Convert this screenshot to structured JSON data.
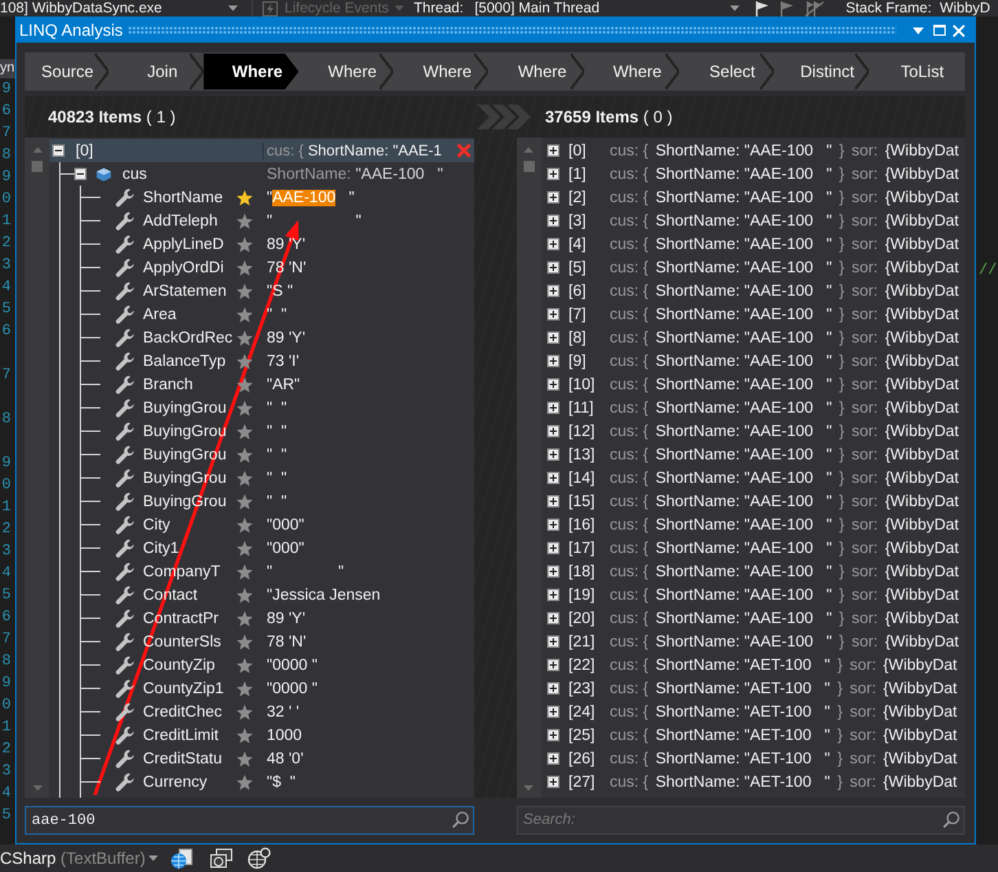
{
  "toolbar": {
    "process": "108] WibbyDataSync.exe",
    "lifecycle": {
      "label": "Lifecycle Events",
      "disabled": true
    },
    "thread_label": "Thread:",
    "thread": "[5000] Main Thread",
    "stack_frame_label": "Stack Frame:",
    "stack_frame": "WibbyD"
  },
  "editor_left": {
    "tab": "yn",
    "line_numbers": [
      [
        "9",
        "6",
        "7",
        "8",
        "9",
        "0",
        "1",
        "2",
        "3",
        "4",
        "5",
        "6"
      ],
      [
        "7"
      ],
      [
        "8"
      ],
      [
        "9",
        "0",
        "1",
        "2",
        "3",
        "4",
        "5",
        "6",
        "7",
        "8",
        "9",
        "0",
        "1",
        "2",
        "3",
        "4",
        "5"
      ]
    ]
  },
  "window": {
    "title": "LINQ Analysis"
  },
  "pipeline": [
    {
      "label": "Source",
      "selected": false
    },
    {
      "label": "Join",
      "selected": false
    },
    {
      "label": "Where",
      "selected": true
    },
    {
      "label": "Where",
      "selected": false
    },
    {
      "label": "Where",
      "selected": false
    },
    {
      "label": "Where",
      "selected": false
    },
    {
      "label": "Where",
      "selected": false
    },
    {
      "label": "Select",
      "selected": false
    },
    {
      "label": "Distinct",
      "selected": false
    },
    {
      "label": "ToList",
      "selected": false
    }
  ],
  "left_panel": {
    "count": "**40823 Items** ( 1 )",
    "tree": {
      "label": "[0]",
      "kind": "item",
      "expanded": true,
      "selected": true,
      "summary": [
        {
          "text": "cus: {",
          "muted": true
        },
        {
          "text": "ShortName: \"AAE-1",
          "muted": false
        }
      ],
      "children": [
        {
          "label": "cus",
          "kind": "object",
          "expanded": true,
          "summary": [
            {
              "text": "ShortName:",
              "muted": true
            },
            {
              "text": "\"AAE-100   \"",
              "muted": false
            }
          ],
          "children": [
            {
              "label": "ShortName",
              "kind": "property",
              "starred": true,
              "value": [
                {
                  "text": "\"",
                  "highlighted": false
                },
                {
                  "text": "AAE-100",
                  "highlighted": true
                },
                {
                  "text": "   \"",
                  "highlighted": false
                }
              ]
            },
            {
              "label": "AddTeleph",
              "kind": "property",
              "starred": false,
              "value": [
                {
                  "text": "\"                   \"",
                  "highlighted": false
                }
              ]
            },
            {
              "label": "ApplyLineD",
              "kind": "property",
              "starred": false,
              "value": [
                {
                  "text": "89 'Y'",
                  "highlighted": false
                }
              ]
            },
            {
              "label": "ApplyOrdDi",
              "kind": "property",
              "starred": false,
              "value": [
                {
                  "text": "78 'N'",
                  "highlighted": false
                }
              ]
            },
            {
              "label": "ArStatemen",
              "kind": "property",
              "starred": false,
              "value": [
                {
                  "text": "\"S \"",
                  "highlighted": false
                }
              ]
            },
            {
              "label": "Area",
              "kind": "property",
              "starred": false,
              "value": [
                {
                  "text": "\"  \"",
                  "highlighted": false
                }
              ]
            },
            {
              "label": "BackOrdRec",
              "kind": "property",
              "starred": false,
              "value": [
                {
                  "text": "89 'Y'",
                  "highlighted": false
                }
              ]
            },
            {
              "label": "BalanceTyp",
              "kind": "property",
              "starred": false,
              "value": [
                {
                  "text": "73 'I'",
                  "highlighted": false
                }
              ]
            },
            {
              "label": "Branch",
              "kind": "property",
              "starred": false,
              "value": [
                {
                  "text": "\"AR\"",
                  "highlighted": false
                }
              ]
            },
            {
              "label": "BuyingGrou",
              "kind": "property",
              "starred": false,
              "value": [
                {
                  "text": "\"  \"",
                  "highlighted": false
                }
              ]
            },
            {
              "label": "BuyingGrou",
              "kind": "property",
              "starred": false,
              "value": [
                {
                  "text": "\"  \"",
                  "highlighted": false
                }
              ]
            },
            {
              "label": "BuyingGrou",
              "kind": "property",
              "starred": false,
              "value": [
                {
                  "text": "\"  \"",
                  "highlighted": false
                }
              ]
            },
            {
              "label": "BuyingGrou",
              "kind": "property",
              "starred": false,
              "value": [
                {
                  "text": "\"  \"",
                  "highlighted": false
                }
              ]
            },
            {
              "label": "BuyingGrou",
              "kind": "property",
              "starred": false,
              "value": [
                {
                  "text": "\"  \"",
                  "highlighted": false
                }
              ]
            },
            {
              "label": "City",
              "kind": "property",
              "starred": false,
              "value": [
                {
                  "text": "\"000\"",
                  "highlighted": false
                }
              ]
            },
            {
              "label": "City1",
              "kind": "property",
              "starred": false,
              "value": [
                {
                  "text": "\"000\"",
                  "highlighted": false
                }
              ]
            },
            {
              "label": "CompanyT",
              "kind": "property",
              "starred": false,
              "value": [
                {
                  "text": "\"               \"",
                  "highlighted": false
                }
              ]
            },
            {
              "label": "Contact",
              "kind": "property",
              "starred": false,
              "value": [
                {
                  "text": "\"Jessica Jensen",
                  "highlighted": false
                }
              ]
            },
            {
              "label": "ContractPr",
              "kind": "property",
              "starred": false,
              "value": [
                {
                  "text": "89 'Y'",
                  "highlighted": false
                }
              ]
            },
            {
              "label": "CounterSls",
              "kind": "property",
              "starred": false,
              "value": [
                {
                  "text": "78 'N'",
                  "highlighted": false
                }
              ]
            },
            {
              "label": "CountyZip",
              "kind": "property",
              "starred": false,
              "value": [
                {
                  "text": "\"0000 \"",
                  "highlighted": false
                }
              ]
            },
            {
              "label": "CountyZip1",
              "kind": "property",
              "starred": false,
              "value": [
                {
                  "text": "\"0000 \"",
                  "highlighted": false
                }
              ]
            },
            {
              "label": "CreditChec",
              "kind": "property",
              "starred": false,
              "value": [
                {
                  "text": "32 ' '",
                  "highlighted": false
                }
              ]
            },
            {
              "label": "CreditLimit",
              "kind": "property",
              "starred": false,
              "value": [
                {
                  "text": "1000",
                  "highlighted": false
                }
              ]
            },
            {
              "label": "CreditStatu",
              "kind": "property",
              "starred": false,
              "value": [
                {
                  "text": "48 '0'",
                  "highlighted": false
                }
              ]
            },
            {
              "label": "Currency",
              "kind": "property",
              "starred": false,
              "value": [
                {
                  "text": "\"$  \"",
                  "highlighted": false
                }
              ]
            }
          ]
        }
      ]
    },
    "search": {
      "value": "aae-100",
      "focused": true
    }
  },
  "right_panel": {
    "count": "**37659 Items** ( 0 )",
    "rows": [
      {
        "index": "[0]",
        "expanded": false,
        "summary": [
          {
            "text": "cus: {",
            "muted": true
          },
          {
            "text": "ShortName: \"AAE-100   \"",
            "muted": false
          },
          {
            "text": "}",
            "muted": true
          },
          {
            "text": "sor:",
            "muted": true
          },
          {
            "text": "{WibbyDat",
            "muted": false
          }
        ]
      },
      {
        "index": "[1]",
        "expanded": false,
        "summary": [
          {
            "text": "cus: {",
            "muted": true
          },
          {
            "text": "ShortName: \"AAE-100   \"",
            "muted": false
          },
          {
            "text": "}",
            "muted": true
          },
          {
            "text": "sor:",
            "muted": true
          },
          {
            "text": "{WibbyDat",
            "muted": false
          }
        ]
      },
      {
        "index": "[2]",
        "expanded": false,
        "summary": [
          {
            "text": "cus: {",
            "muted": true
          },
          {
            "text": "ShortName: \"AAE-100   \"",
            "muted": false
          },
          {
            "text": "}",
            "muted": true
          },
          {
            "text": "sor:",
            "muted": true
          },
          {
            "text": "{WibbyDat",
            "muted": false
          }
        ]
      },
      {
        "index": "[3]",
        "expanded": false,
        "summary": [
          {
            "text": "cus: {",
            "muted": true
          },
          {
            "text": "ShortName: \"AAE-100   \"",
            "muted": false
          },
          {
            "text": "}",
            "muted": true
          },
          {
            "text": "sor:",
            "muted": true
          },
          {
            "text": "{WibbyDat",
            "muted": false
          }
        ]
      },
      {
        "index": "[4]",
        "expanded": false,
        "summary": [
          {
            "text": "cus: {",
            "muted": true
          },
          {
            "text": "ShortName: \"AAE-100   \"",
            "muted": false
          },
          {
            "text": "}",
            "muted": true
          },
          {
            "text": "sor:",
            "muted": true
          },
          {
            "text": "{WibbyDat",
            "muted": false
          }
        ]
      },
      {
        "index": "[5]",
        "expanded": false,
        "summary": [
          {
            "text": "cus: {",
            "muted": true
          },
          {
            "text": "ShortName: \"AAE-100   \"",
            "muted": false
          },
          {
            "text": "}",
            "muted": true
          },
          {
            "text": "sor:",
            "muted": true
          },
          {
            "text": "{WibbyDat",
            "muted": false
          }
        ]
      },
      {
        "index": "[6]",
        "expanded": false,
        "summary": [
          {
            "text": "cus: {",
            "muted": true
          },
          {
            "text": "ShortName: \"AAE-100   \"",
            "muted": false
          },
          {
            "text": "}",
            "muted": true
          },
          {
            "text": "sor:",
            "muted": true
          },
          {
            "text": "{WibbyDat",
            "muted": false
          }
        ]
      },
      {
        "index": "[7]",
        "expanded": false,
        "summary": [
          {
            "text": "cus: {",
            "muted": true
          },
          {
            "text": "ShortName: \"AAE-100   \"",
            "muted": false
          },
          {
            "text": "}",
            "muted": true
          },
          {
            "text": "sor:",
            "muted": true
          },
          {
            "text": "{WibbyDat",
            "muted": false
          }
        ]
      },
      {
        "index": "[8]",
        "expanded": false,
        "summary": [
          {
            "text": "cus: {",
            "muted": true
          },
          {
            "text": "ShortName: \"AAE-100   \"",
            "muted": false
          },
          {
            "text": "}",
            "muted": true
          },
          {
            "text": "sor:",
            "muted": true
          },
          {
            "text": "{WibbyDat",
            "muted": false
          }
        ]
      },
      {
        "index": "[9]",
        "expanded": false,
        "summary": [
          {
            "text": "cus: {",
            "muted": true
          },
          {
            "text": "ShortName: \"AAE-100   \"",
            "muted": false
          },
          {
            "text": "}",
            "muted": true
          },
          {
            "text": "sor:",
            "muted": true
          },
          {
            "text": "{WibbyDat",
            "muted": false
          }
        ]
      },
      {
        "index": "[10]",
        "expanded": false,
        "summary": [
          {
            "text": "cus: {",
            "muted": true
          },
          {
            "text": "ShortName: \"AAE-100   \"",
            "muted": false
          },
          {
            "text": "}",
            "muted": true
          },
          {
            "text": "sor:",
            "muted": true
          },
          {
            "text": "{WibbyDat",
            "muted": false
          }
        ]
      },
      {
        "index": "[11]",
        "expanded": false,
        "summary": [
          {
            "text": "cus: {",
            "muted": true
          },
          {
            "text": "ShortName: \"AAE-100   \"",
            "muted": false
          },
          {
            "text": "}",
            "muted": true
          },
          {
            "text": "sor:",
            "muted": true
          },
          {
            "text": "{WibbyDat",
            "muted": false
          }
        ]
      },
      {
        "index": "[12]",
        "expanded": false,
        "summary": [
          {
            "text": "cus: {",
            "muted": true
          },
          {
            "text": "ShortName: \"AAE-100   \"",
            "muted": false
          },
          {
            "text": "}",
            "muted": true
          },
          {
            "text": "sor:",
            "muted": true
          },
          {
            "text": "{WibbyDat",
            "muted": false
          }
        ]
      },
      {
        "index": "[13]",
        "expanded": false,
        "summary": [
          {
            "text": "cus: {",
            "muted": true
          },
          {
            "text": "ShortName: \"AAE-100   \"",
            "muted": false
          },
          {
            "text": "}",
            "muted": true
          },
          {
            "text": "sor:",
            "muted": true
          },
          {
            "text": "{WibbyDat",
            "muted": false
          }
        ]
      },
      {
        "index": "[14]",
        "expanded": false,
        "summary": [
          {
            "text": "cus: {",
            "muted": true
          },
          {
            "text": "ShortName: \"AAE-100   \"",
            "muted": false
          },
          {
            "text": "}",
            "muted": true
          },
          {
            "text": "sor:",
            "muted": true
          },
          {
            "text": "{WibbyDat",
            "muted": false
          }
        ]
      },
      {
        "index": "[15]",
        "expanded": false,
        "summary": [
          {
            "text": "cus: {",
            "muted": true
          },
          {
            "text": "ShortName: \"AAE-100   \"",
            "muted": false
          },
          {
            "text": "}",
            "muted": true
          },
          {
            "text": "sor:",
            "muted": true
          },
          {
            "text": "{WibbyDat",
            "muted": false
          }
        ]
      },
      {
        "index": "[16]",
        "expanded": false,
        "summary": [
          {
            "text": "cus: {",
            "muted": true
          },
          {
            "text": "ShortName: \"AAE-100   \"",
            "muted": false
          },
          {
            "text": "}",
            "muted": true
          },
          {
            "text": "sor:",
            "muted": true
          },
          {
            "text": "{WibbyDat",
            "muted": false
          }
        ]
      },
      {
        "index": "[17]",
        "expanded": false,
        "summary": [
          {
            "text": "cus: {",
            "muted": true
          },
          {
            "text": "ShortName: \"AAE-100   \"",
            "muted": false
          },
          {
            "text": "}",
            "muted": true
          },
          {
            "text": "sor:",
            "muted": true
          },
          {
            "text": "{WibbyDat",
            "muted": false
          }
        ]
      },
      {
        "index": "[18]",
        "expanded": false,
        "summary": [
          {
            "text": "cus: {",
            "muted": true
          },
          {
            "text": "ShortName: \"AAE-100   \"",
            "muted": false
          },
          {
            "text": "}",
            "muted": true
          },
          {
            "text": "sor:",
            "muted": true
          },
          {
            "text": "{WibbyDat",
            "muted": false
          }
        ]
      },
      {
        "index": "[19]",
        "expanded": false,
        "summary": [
          {
            "text": "cus: {",
            "muted": true
          },
          {
            "text": "ShortName: \"AAE-100   \"",
            "muted": false
          },
          {
            "text": "}",
            "muted": true
          },
          {
            "text": "sor:",
            "muted": true
          },
          {
            "text": "{WibbyDat",
            "muted": false
          }
        ]
      },
      {
        "index": "[20]",
        "expanded": false,
        "summary": [
          {
            "text": "cus: {",
            "muted": true
          },
          {
            "text": "ShortName: \"AAE-100   \"",
            "muted": false
          },
          {
            "text": "}",
            "muted": true
          },
          {
            "text": "sor:",
            "muted": true
          },
          {
            "text": "{WibbyDat",
            "muted": false
          }
        ]
      },
      {
        "index": "[21]",
        "expanded": false,
        "summary": [
          {
            "text": "cus: {",
            "muted": true
          },
          {
            "text": "ShortName: \"AAE-100   \"",
            "muted": false
          },
          {
            "text": "}",
            "muted": true
          },
          {
            "text": "sor:",
            "muted": true
          },
          {
            "text": "{WibbyDat",
            "muted": false
          }
        ]
      },
      {
        "index": "[22]",
        "expanded": false,
        "summary": [
          {
            "text": "cus: {",
            "muted": true
          },
          {
            "text": "ShortName: \"AET-100   \"",
            "muted": false
          },
          {
            "text": "}",
            "muted": true
          },
          {
            "text": "sor:",
            "muted": true
          },
          {
            "text": "{WibbyDat",
            "muted": false
          }
        ]
      },
      {
        "index": "[23]",
        "expanded": false,
        "summary": [
          {
            "text": "cus: {",
            "muted": true
          },
          {
            "text": "ShortName: \"AET-100   \"",
            "muted": false
          },
          {
            "text": "}",
            "muted": true
          },
          {
            "text": "sor:",
            "muted": true
          },
          {
            "text": "{WibbyDat",
            "muted": false
          }
        ]
      },
      {
        "index": "[24]",
        "expanded": false,
        "summary": [
          {
            "text": "cus: {",
            "muted": true
          },
          {
            "text": "ShortName: \"AET-100   \"",
            "muted": false
          },
          {
            "text": "}",
            "muted": true
          },
          {
            "text": "sor:",
            "muted": true
          },
          {
            "text": "{WibbyDat",
            "muted": false
          }
        ]
      },
      {
        "index": "[25]",
        "expanded": false,
        "summary": [
          {
            "text": "cus: {",
            "muted": true
          },
          {
            "text": "ShortName: \"AET-100   \"",
            "muted": false
          },
          {
            "text": "}",
            "muted": true
          },
          {
            "text": "sor:",
            "muted": true
          },
          {
            "text": "{WibbyDat",
            "muted": false
          }
        ]
      },
      {
        "index": "[26]",
        "expanded": false,
        "summary": [
          {
            "text": "cus: {",
            "muted": true
          },
          {
            "text": "ShortName: \"AET-100   \"",
            "muted": false
          },
          {
            "text": "}",
            "muted": true
          },
          {
            "text": "sor:",
            "muted": true
          },
          {
            "text": "{WibbyDat",
            "muted": false
          }
        ]
      },
      {
        "index": "[27]",
        "expanded": false,
        "summary": [
          {
            "text": "cus: {",
            "muted": true
          },
          {
            "text": "ShortName: \"AET-100   \"",
            "muted": false
          },
          {
            "text": "}",
            "muted": true
          },
          {
            "text": "sor:",
            "muted": true
          },
          {
            "text": "{WibbyDat",
            "muted": false
          }
        ]
      }
    ],
    "search": {
      "placeholder": "Search:",
      "focused": false
    }
  },
  "editor_right": {
    "comment": "//"
  },
  "status_bar": {
    "language": "CSharp",
    "buffer": "(TextBuffer)"
  }
}
